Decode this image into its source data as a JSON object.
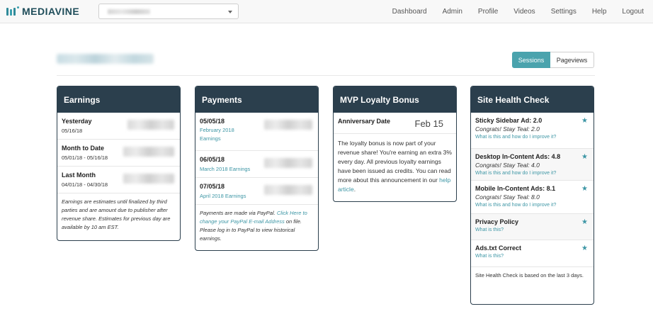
{
  "brand": {
    "logo_text": "MEDIAVINE",
    "accent": "#4aa3ad",
    "panel_header": "#2b3f4d"
  },
  "nav": {
    "links": [
      "Dashboard",
      "Admin",
      "Profile",
      "Videos",
      "Settings",
      "Help",
      "Logout"
    ]
  },
  "toggle": {
    "sessions": "Sessions",
    "pageviews": "Pageviews",
    "active": "Sessions"
  },
  "earnings": {
    "title": "Earnings",
    "rows": [
      {
        "label": "Yesterday",
        "date": "05/16/18"
      },
      {
        "label": "Month to Date",
        "date": "05/01/18 - 05/16/18"
      },
      {
        "label": "Last Month",
        "date": "04/01/18 - 04/30/18"
      }
    ],
    "note": "Earnings are estimates until finalized by third parties and are amount due to publisher after revenue share. Estimates for previous day are available by 10 am EST."
  },
  "payments": {
    "title": "Payments",
    "rows": [
      {
        "date": "05/05/18",
        "desc1": "February 2018",
        "desc2": "Earnings"
      },
      {
        "date": "06/05/18",
        "desc1": "March 2018 Earnings"
      },
      {
        "date": "07/05/18",
        "desc1": "April 2018 Earnings"
      }
    ],
    "note_prefix": "Payments are made via PayPal. ",
    "note_link": "Click Here to change your PayPal E-mail Address",
    "note_suffix": " on file. Please log in to PayPal to view historical earnings."
  },
  "loyalty": {
    "title": "MVP Loyalty Bonus",
    "anniversary_label": "Anniversary Date",
    "anniversary_date": "Feb 15",
    "body_prefix": "The loyalty bonus is now part of your revenue share! You're earning an extra 3% every day. All previous loyalty earnings have been issued as credits. You can read more about this announcement in our ",
    "body_link": "help article",
    "body_suffix": "."
  },
  "health": {
    "title": "Site Health Check",
    "items": [
      {
        "title": "Sticky Sidebar Ad: 2.0",
        "status": "Congrats! Stay Teal: 2.0",
        "link": "What is this and how do I improve it?"
      },
      {
        "title": "Desktop In-Content Ads: 4.8",
        "status": "Congrats! Stay Teal: 4.0",
        "link": "What is this and how do I improve it?"
      },
      {
        "title": "Mobile In-Content Ads: 8.1",
        "status": "Congrats! Stay Teal: 8.0",
        "link": "What is this and how do I improve it?"
      },
      {
        "title": "Privacy Policy",
        "link": "What is this?"
      },
      {
        "title": "Ads.txt Correct",
        "link": "What is this?"
      }
    ],
    "note": "Site Health Check is based on the last 3 days.",
    "star": "★"
  }
}
